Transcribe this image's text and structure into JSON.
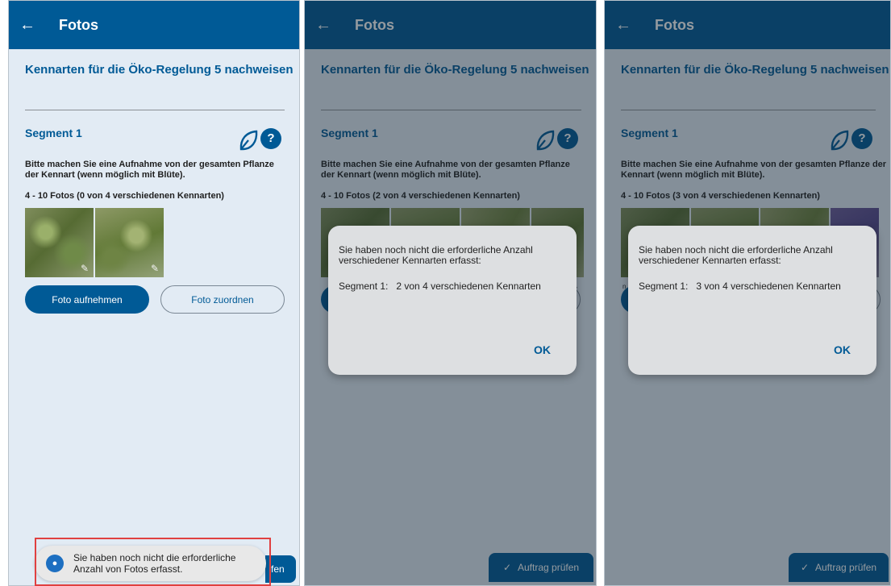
{
  "appbar": {
    "back_icon": "←",
    "title": "Fotos"
  },
  "page": {
    "heading": "Kennarten für die Öko-Regelung 5 nachweisen",
    "segment_title": "Segment 1",
    "leaf_icon": "leaf-icon",
    "help_label": "?",
    "instruction": "Bitte machen Sie eine Aufnahme von der gesamten Pflanze der Kennart (wenn möglich mit Blüte)."
  },
  "panels": [
    {
      "count_text": "4 - 10 Fotos  (0 von 4 verschiedenen Kennarten)"
    },
    {
      "count_text": "4 - 10 Fotos  (2 von 4 verschiedenen Kennarten)"
    },
    {
      "count_text": "4 - 10 Fotos  (3 von 4 verschiedenen Kennarten)"
    }
  ],
  "buttons": {
    "take_photo": "Foto aufnehmen",
    "assign_photo": "Foto zuordnen",
    "check_job": "Auftrag prüfen",
    "check_job_partial": "fen"
  },
  "dialog": {
    "message": "Sie haben noch nicht die erforderliche Anzahl verschiedener Kennarten erfasst:",
    "ok": "OK",
    "seg_p2": "Segment 1:   2 von 4 verschiedenen Kennarten",
    "seg_p3": "Segment 1:   3 von 4 verschiedenen Kennarten"
  },
  "partial_text": {
    "p2_right_1": "ß",
    "p2_right_2": "e",
    "p3_left_1": "n",
    "p3_left_2": "s"
  },
  "toast": {
    "icon": "app-icon",
    "text": "Sie haben noch nicht die erforderliche Anzahl von Fotos erfasst."
  },
  "colors": {
    "primary": "#005a96",
    "background": "#e2ebf4",
    "dialog": "#dddfe1",
    "highlight": "#e04040"
  }
}
